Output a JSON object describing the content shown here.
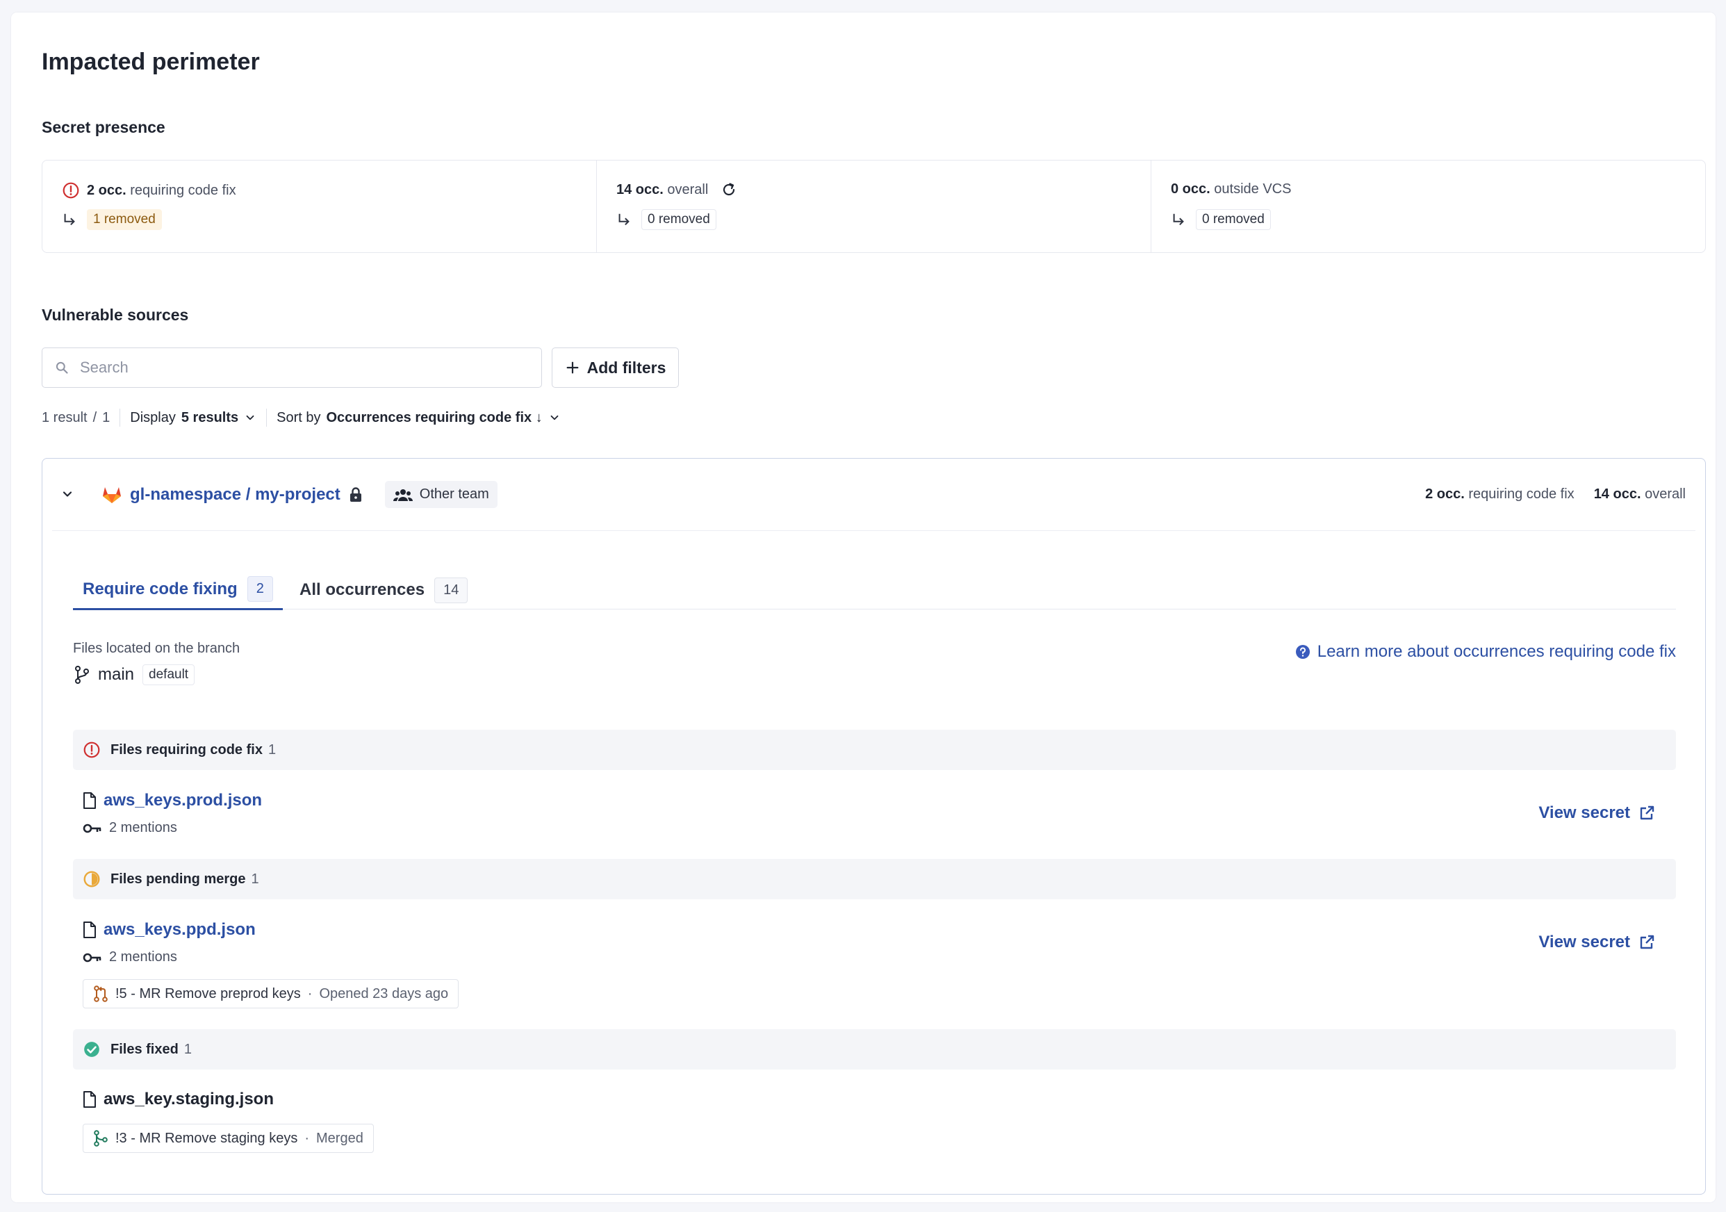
{
  "page": {
    "title": "Impacted perimeter"
  },
  "secret_presence": {
    "title": "Secret presence",
    "cols": [
      {
        "count": "2 occ.",
        "label": "requiring code fix",
        "removed": "1 removed"
      },
      {
        "count": "14 occ.",
        "label": "overall",
        "removed": "0 removed"
      },
      {
        "count": "0 occ.",
        "label": "outside VCS",
        "removed": "0 removed"
      }
    ]
  },
  "vulnerable_sources": {
    "title": "Vulnerable sources",
    "search_placeholder": "Search",
    "add_filters_label": "Add filters",
    "result_count": "1 result",
    "result_sep": "/",
    "result_total": "1",
    "display_label": "Display",
    "display_value": "5 results",
    "sort_label": "Sort by",
    "sort_value": "Occurrences requiring code fix ↓"
  },
  "project": {
    "name": "gl-namespace / my-project",
    "team": "Other team",
    "stat_fix_count": "2 occ.",
    "stat_fix_label": "requiring code fix",
    "stat_overall_count": "14 occ.",
    "stat_overall_label": "overall",
    "tabs": [
      {
        "label": "Require code fixing",
        "count": "2"
      },
      {
        "label": "All occurrences",
        "count": "14"
      }
    ],
    "branch_caption": "Files located on the branch",
    "branch_name": "main",
    "branch_badge": "default",
    "learn_more": "Learn more about occurrences requiring code fix",
    "groups": {
      "fix": {
        "label": "Files requiring code fix",
        "count": "1"
      },
      "pending": {
        "label": "Files pending merge",
        "count": "1"
      },
      "fixed": {
        "label": "Files fixed",
        "count": "1"
      }
    },
    "files": {
      "prod": {
        "name": "aws_keys.prod.json",
        "mentions": "2 mentions",
        "action": "View secret"
      },
      "ppd": {
        "name": "aws_keys.ppd.json",
        "mentions": "2 mentions",
        "action": "View secret",
        "mr": "!5 - MR Remove preprod keys",
        "mr_status": "Opened 23 days ago"
      },
      "staging": {
        "name": "aws_key.staging.json",
        "mr": "!3 - MR Remove staging keys",
        "mr_status": "Merged"
      }
    },
    "dot": "·"
  },
  "colors": {
    "accent": "#2c4fa3",
    "danger": "#cf2f2f",
    "warning": "#e9a83a",
    "success": "#3bb08f"
  }
}
